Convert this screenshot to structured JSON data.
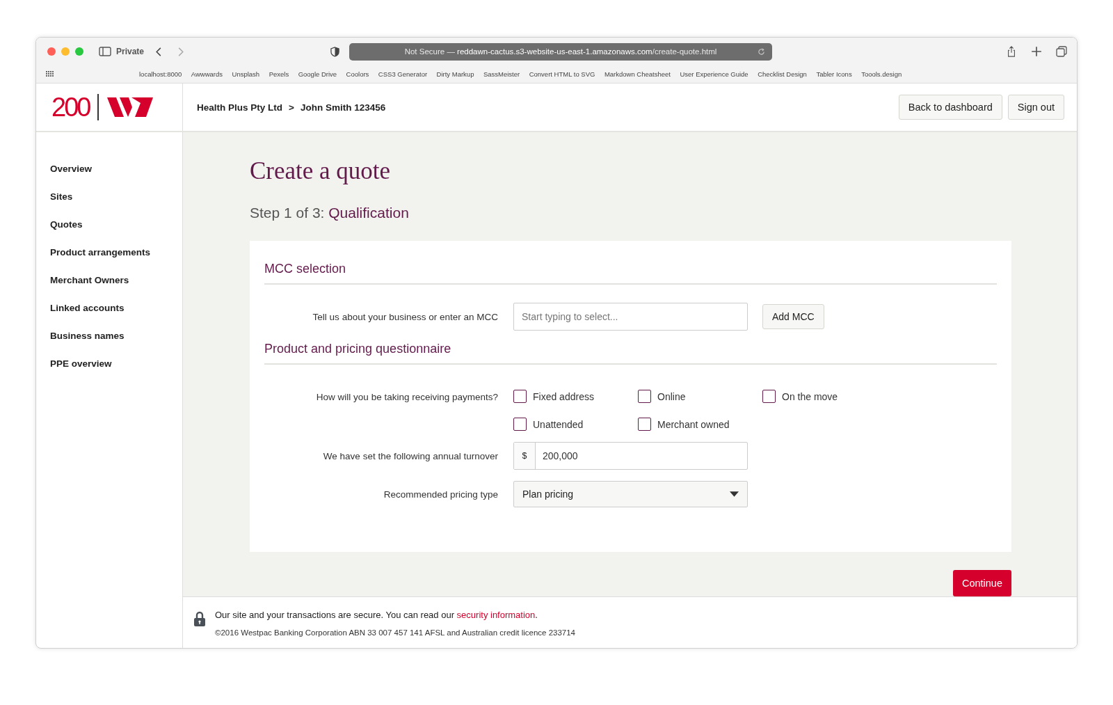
{
  "browser": {
    "tab_label": "Private",
    "address": {
      "prefix": "Not Secure — ",
      "host": "reddawn-cactus.s3-website-us-east-1.amazonaws.com",
      "path": "/create-quote.html"
    },
    "bookmarks": [
      "localhost:8000",
      "Awwwards",
      "Unsplash",
      "Pexels",
      "Google Drive",
      "Coolors",
      "CSS3 Generator",
      "Dirty Markup",
      "SassMeister",
      "Convert HTML to SVG",
      "Markdown Cheatsheet",
      "User Experience Guide",
      "Checklist Design",
      "Tabler Icons",
      "Toools.design"
    ]
  },
  "header": {
    "logo_text": "200",
    "breadcrumb": [
      "Health Plus Pty Ltd",
      "John Smith 123456"
    ],
    "separator": ">",
    "buttons": [
      "Back to dashboard",
      "Sign out"
    ]
  },
  "sidebar": {
    "items": [
      "Overview",
      "Sites",
      "Quotes",
      "Product arrangements",
      "Merchant Owners",
      "Linked accounts",
      "Business names",
      "PPE overview"
    ]
  },
  "page": {
    "title": "Create a quote",
    "step": {
      "prefix": "Step 1 of 3:",
      "name": "Qualification"
    }
  },
  "mcc": {
    "heading": "MCC selection",
    "label": "Tell us about your business or enter an MCC",
    "placeholder": "Start typing to select...",
    "button": "Add MCC"
  },
  "questionnaire": {
    "heading": "Product and pricing questionnaire",
    "payments_label": "How will you be taking receiving payments?",
    "options": [
      {
        "label": "Fixed address",
        "checked": false
      },
      {
        "label": "Online",
        "checked": false
      },
      {
        "label": "On the move",
        "checked": false
      },
      {
        "label": "Unattended",
        "checked": false
      },
      {
        "label": "Merchant owned",
        "checked": false
      }
    ],
    "turnover_label": "We have set the following annual turnover",
    "currency": "$",
    "turnover": "200,000",
    "pricing_label": "Recommended pricing type",
    "pricing": "Plan pricing"
  },
  "continue": "Continue",
  "footer": {
    "secure_prefix": "Our site and your transactions are secure. You can read our ",
    "link": "security information",
    "secure_suffix": ".",
    "copyright": "©2016 Westpac Banking Corporation ABN 33 007 457 141 AFSL and Australian credit licence 233714"
  }
}
